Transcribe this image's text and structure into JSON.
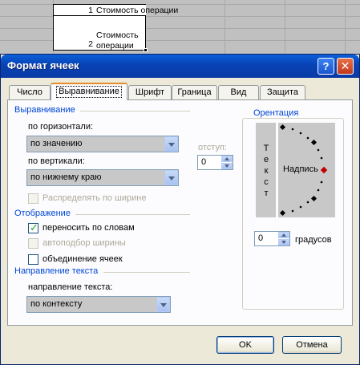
{
  "sheet": {
    "row1": {
      "number": "1",
      "text": "Стоимость операции"
    },
    "row2": {
      "number": "2",
      "text_line1": "Стоимость",
      "text_line2": "операции"
    }
  },
  "dialog": {
    "title": "Формат ячеек",
    "help_icon": "?",
    "close_icon": "✕",
    "tabs": [
      {
        "label": "Число"
      },
      {
        "label": "Выравнивание",
        "active": true
      },
      {
        "label": "Шрифт"
      },
      {
        "label": "Граница"
      },
      {
        "label": "Вид"
      },
      {
        "label": "Защита"
      }
    ],
    "alignment": {
      "title": "Выравнивание",
      "horizontal_label": "по горизонтали:",
      "horizontal_value": "по значению",
      "vertical_label": "по вертикали:",
      "vertical_value": "по нижнему краю",
      "indent_label": "отступ:",
      "indent_value": "0",
      "distribute_label": "Распределять по ширине"
    },
    "display": {
      "title": "Отображение",
      "wrap_label": "переносить по словам",
      "wrap_checked": true,
      "shrink_label": "автоподбор ширины",
      "merge_label": "объединение ячеек"
    },
    "direction": {
      "title": "Направление текста",
      "label": "направление текста:",
      "value": "по контексту"
    },
    "orientation": {
      "title": "Орентация",
      "vertical_text": "Текст",
      "arc_label": "Надпись",
      "degrees_value": "0",
      "degrees_label": "градусов"
    },
    "buttons": {
      "ok": "OK",
      "cancel": "Отмена"
    },
    "colors": {
      "title_bar": "#0a4fc8",
      "group_title": "#0046d5",
      "active_tab_accent": "#e68b2c"
    }
  }
}
